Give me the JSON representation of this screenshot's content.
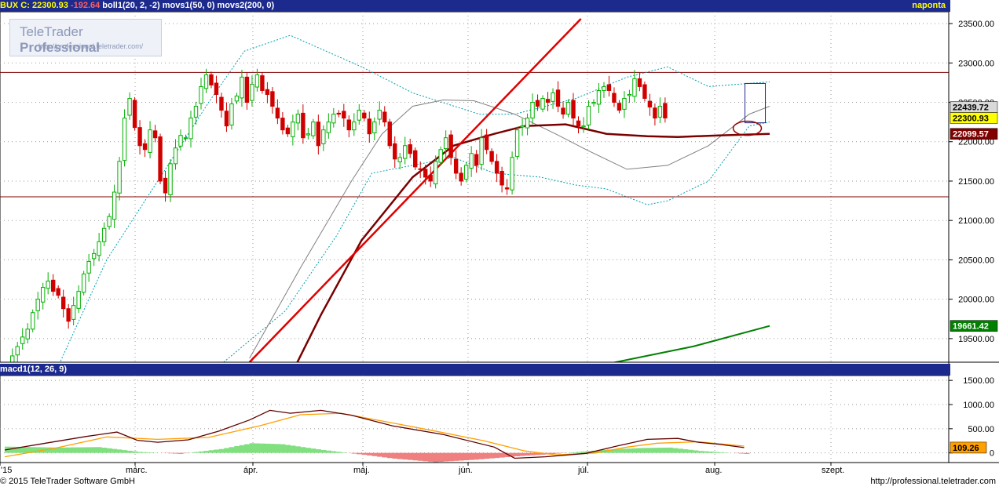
{
  "header": {
    "symbol": "BUX",
    "close_label": "C:",
    "close": "22300.93",
    "change": "-192.64",
    "indicators": "boll1(20, 2, -2) movs1(50, 0) movs2(200, 0)",
    "period": "naponta"
  },
  "macd_header": "macd1(12, 26, 9)",
  "logo": {
    "title_light": "TeleTrader",
    "title_bold": "Professional",
    "url": "http://professional.teletrader.com/"
  },
  "footer": {
    "copyright": "© 2015 TeleTrader Software GmbH",
    "url": "http://professional.teletrader.com"
  },
  "chart_data": [
    {
      "type": "candlestick",
      "y_axis": {
        "ylim": [
          19200,
          23650
        ],
        "tick_labels": [
          "23500.00",
          "23000.00",
          "22500.00",
          "22000.00",
          "21500.00",
          "21000.00",
          "20500.00",
          "20000.00",
          "19500.00"
        ],
        "ticks": [
          23500,
          23000,
          22500,
          22000,
          21500,
          21000,
          20500,
          20000,
          19500
        ]
      },
      "x_axis": {
        "tick_labels": [
          "'15",
          "márc.",
          "ápr.",
          "máj.",
          "jún.",
          "júl.",
          "aug.",
          "szept."
        ]
      },
      "price_tags": [
        {
          "label": "22439.72",
          "value": 22439.72,
          "color": "#000000",
          "bg": "#d9d9d9"
        },
        {
          "label": "22300.93",
          "value": 22300.93,
          "color": "#000000",
          "bg": "#ffff00"
        },
        {
          "label": "22099.57",
          "value": 22099.57,
          "color": "#ffffff",
          "bg": "#800000"
        },
        {
          "label": "19661.42",
          "value": 19661.42,
          "color": "#ffffff",
          "bg": "#008000"
        }
      ],
      "horizontal_lines": [
        22880,
        21300
      ],
      "candle_closes": [
        19150,
        19280,
        19400,
        19520,
        19620,
        19830,
        20000,
        20150,
        20230,
        20100,
        20050,
        19880,
        19720,
        19920,
        20100,
        20320,
        20480,
        20580,
        20730,
        20900,
        21050,
        21360,
        21750,
        22300,
        22550,
        22180,
        21950,
        21900,
        22150,
        22050,
        21500,
        21350,
        21720,
        21920,
        22080,
        22050,
        22300,
        22450,
        22700,
        22850,
        22720,
        22600,
        22400,
        22200,
        22480,
        22580,
        22820,
        22500,
        22730,
        22850,
        22650,
        22600,
        22450,
        22300,
        22150,
        22100,
        22250,
        22350,
        22050,
        22100,
        22250,
        21950,
        22150,
        22250,
        22350,
        22350,
        22300,
        22150,
        22250,
        22400,
        22300,
        22100,
        22250,
        22400,
        22250,
        21950,
        21780,
        21800,
        21950,
        21850,
        21680,
        21650,
        21550,
        21500,
        21750,
        21900,
        22050,
        21800,
        21600,
        21500,
        21700,
        21850,
        21700,
        22050,
        21900,
        21750,
        21600,
        21450,
        21400,
        21800,
        22150,
        22200,
        22300,
        22500,
        22450,
        22550,
        22500,
        22620,
        22450,
        22350,
        22500,
        22300,
        22200,
        22200,
        22450,
        22500,
        22650,
        22700,
        22650,
        22500,
        22400,
        22550,
        22600,
        22800,
        22700,
        22550,
        22440,
        22300,
        22450,
        22301
      ],
      "boll_upper_points": [
        [
          1,
          17800
        ],
        [
          20,
          20500
        ],
        [
          40,
          22500
        ],
        [
          47,
          23150
        ],
        [
          56,
          23350
        ],
        [
          70,
          22950
        ],
        [
          80,
          22620
        ],
        [
          93,
          22350
        ],
        [
          100,
          22350
        ],
        [
          112,
          22550
        ],
        [
          122,
          22820
        ],
        [
          130,
          22950
        ],
        [
          138,
          22700
        ],
        [
          150,
          22760
        ]
      ],
      "boll_lower_points": [
        [
          42,
          19150
        ],
        [
          55,
          19850
        ],
        [
          65,
          20800
        ],
        [
          72,
          21600
        ],
        [
          80,
          21700
        ],
        [
          88,
          21800
        ],
        [
          96,
          21600
        ],
        [
          105,
          21550
        ],
        [
          112,
          21450
        ],
        [
          118,
          21400
        ],
        [
          122,
          21300
        ],
        [
          126,
          21200
        ],
        [
          130,
          21250
        ],
        [
          138,
          21500
        ],
        [
          146,
          22200
        ],
        [
          150,
          22250
        ]
      ],
      "ma20_points": [
        [
          48,
          19250
        ],
        [
          58,
          20400
        ],
        [
          68,
          21500
        ],
        [
          74,
          22100
        ],
        [
          80,
          22450
        ],
        [
          86,
          22530
        ],
        [
          92,
          22520
        ],
        [
          100,
          22350
        ],
        [
          108,
          22100
        ],
        [
          114,
          21900
        ],
        [
          122,
          21650
        ],
        [
          130,
          21700
        ],
        [
          138,
          21950
        ],
        [
          146,
          22350
        ],
        [
          150,
          22450
        ]
      ],
      "movs1_points": [
        [
          57,
          19150
        ],
        [
          62,
          19800
        ],
        [
          70,
          20750
        ],
        [
          80,
          21550
        ],
        [
          88,
          21950
        ],
        [
          96,
          22100
        ],
        [
          102,
          22200
        ],
        [
          110,
          22220
        ],
        [
          118,
          22100
        ],
        [
          126,
          22070
        ],
        [
          132,
          22060
        ],
        [
          140,
          22080
        ],
        [
          150,
          22100
        ]
      ],
      "movs2_points": [
        [
          116,
          19150
        ],
        [
          135,
          19400
        ],
        [
          150,
          19661
        ]
      ],
      "trendline_points": [
        [
          48,
          19200
        ],
        [
          113,
          23560
        ]
      ],
      "annotations": [
        "rectangle around last candles",
        "ellipse around last candles"
      ],
      "colors": {
        "up": "#00b000",
        "down": "#d00000",
        "boll": "#00a0b0",
        "ma20": "#808080",
        "movs1": "#7a0000",
        "movs2": "#008000",
        "trend": "#e00000",
        "hline": "#800000"
      }
    },
    {
      "type": "macd",
      "name": "macd1(12, 26, 9)",
      "y_axis": {
        "ylim": [
          -200,
          1600
        ],
        "tick_labels": [
          "1500.00",
          "1000.00",
          "500.00",
          "0"
        ],
        "ticks": [
          1500,
          1000,
          500,
          0
        ]
      },
      "price_tag": {
        "label": "109.26",
        "value": 109.26,
        "bg": "#ffa000"
      },
      "macd_points": [
        [
          0,
          60
        ],
        [
          8,
          200
        ],
        [
          16,
          340
        ],
        [
          22,
          430
        ],
        [
          26,
          260
        ],
        [
          30,
          220
        ],
        [
          36,
          270
        ],
        [
          42,
          450
        ],
        [
          48,
          680
        ],
        [
          52,
          880
        ],
        [
          56,
          820
        ],
        [
          62,
          880
        ],
        [
          68,
          780
        ],
        [
          76,
          560
        ],
        [
          86,
          380
        ],
        [
          96,
          120
        ],
        [
          100,
          -110
        ],
        [
          106,
          -80
        ],
        [
          114,
          -10
        ],
        [
          120,
          140
        ],
        [
          126,
          280
        ],
        [
          132,
          300
        ],
        [
          136,
          220
        ],
        [
          140,
          180
        ],
        [
          145,
          109
        ]
      ],
      "signal_points": [
        [
          0,
          -80
        ],
        [
          10,
          100
        ],
        [
          20,
          330
        ],
        [
          30,
          280
        ],
        [
          40,
          320
        ],
        [
          50,
          560
        ],
        [
          58,
          790
        ],
        [
          66,
          820
        ],
        [
          74,
          660
        ],
        [
          84,
          460
        ],
        [
          94,
          250
        ],
        [
          102,
          40
        ],
        [
          108,
          -40
        ],
        [
          116,
          0
        ],
        [
          122,
          120
        ],
        [
          128,
          200
        ],
        [
          136,
          230
        ],
        [
          145,
          140
        ]
      ],
      "histogram_points": [
        [
          0,
          130
        ],
        [
          10,
          110
        ],
        [
          18,
          120
        ],
        [
          26,
          20
        ],
        [
          34,
          -20
        ],
        [
          42,
          80
        ],
        [
          48,
          200
        ],
        [
          54,
          180
        ],
        [
          62,
          60
        ],
        [
          70,
          -40
        ],
        [
          76,
          -120
        ],
        [
          84,
          -190
        ],
        [
          92,
          -140
        ],
        [
          100,
          -70
        ],
        [
          106,
          -30
        ],
        [
          112,
          20
        ],
        [
          118,
          70
        ],
        [
          124,
          100
        ],
        [
          130,
          110
        ],
        [
          136,
          40
        ],
        [
          145,
          -20
        ]
      ],
      "colors": {
        "macd": "#600000",
        "signal": "#ffa000",
        "hist_pos": "#80e080",
        "hist_neg": "#f08080"
      }
    }
  ]
}
